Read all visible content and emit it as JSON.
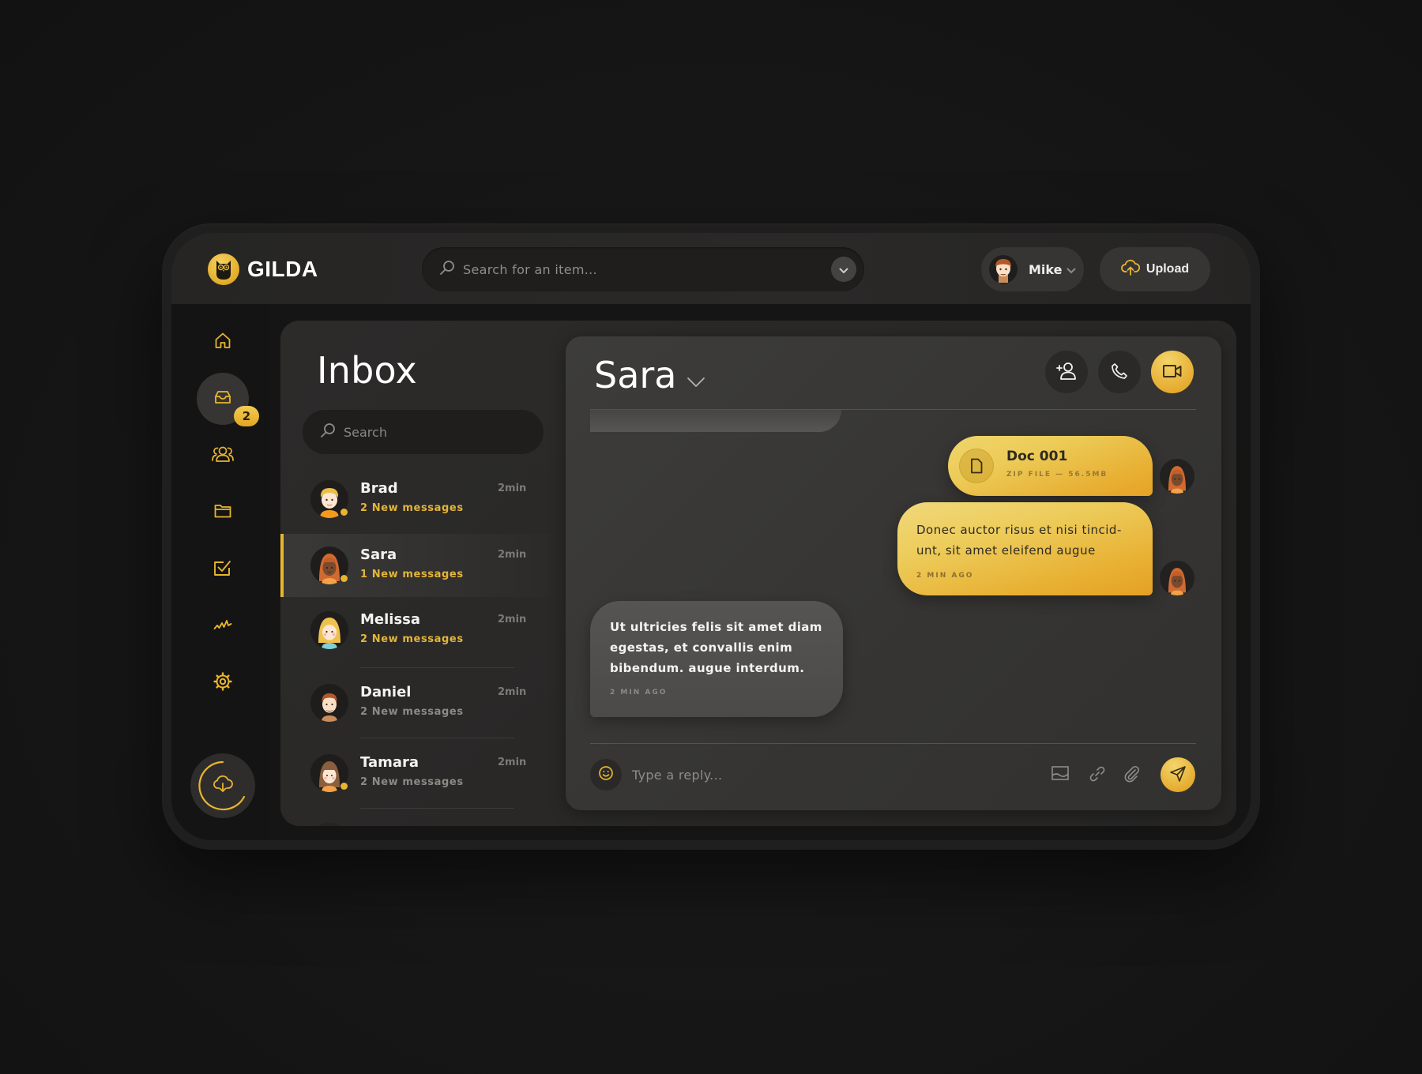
{
  "app": {
    "brand": "GILDA",
    "accent_color": "#E9B52F"
  },
  "topbar": {
    "search_placeholder": "Search for an item...",
    "user_name": "Mike",
    "upload_label": "Upload"
  },
  "sidebar": {
    "items": [
      {
        "name": "home",
        "icon": "home-icon"
      },
      {
        "name": "inbox",
        "icon": "inbox-icon",
        "active": true,
        "badge": "2"
      },
      {
        "name": "contacts",
        "icon": "users-icon"
      },
      {
        "name": "files",
        "icon": "folder-icon"
      },
      {
        "name": "tasks",
        "icon": "checkbox-icon"
      },
      {
        "name": "activity",
        "icon": "activity-icon"
      },
      {
        "name": "settings",
        "icon": "gear-icon"
      }
    ],
    "sync_icon": "cloud-download-icon"
  },
  "inbox": {
    "title": "Inbox",
    "search_placeholder": "Search",
    "conversations": [
      {
        "name": "Brad",
        "status": "2 New messages",
        "time": "2min",
        "unread": true,
        "online": true
      },
      {
        "name": "Sara",
        "status": "1 New messages",
        "time": "2min",
        "unread": true,
        "online": true,
        "active": true
      },
      {
        "name": "Melissa",
        "status": "2 New messages",
        "time": "2min",
        "unread": true,
        "online": false
      },
      {
        "name": "Daniel",
        "status": "2 New messages",
        "time": "2min",
        "unread": false,
        "online": false
      },
      {
        "name": "Tamara",
        "status": "2 New messages",
        "time": "2min",
        "unread": false,
        "online": true
      }
    ]
  },
  "chat": {
    "contact_name": "Sara",
    "messages": [
      {
        "type": "file",
        "file_name": "Doc 001",
        "file_meta": "ZIP FILE — 56.5MB",
        "outgoing": true
      },
      {
        "type": "text",
        "text": "Donec auctor risus et nisi tincid-unt, sit amet eleifend augue",
        "time": "2 MIN AGO",
        "outgoing": true
      },
      {
        "type": "text",
        "text": "Ut ultricies felis sit amet diam egestas, et convallis enim bibendum. augue interdum.",
        "time": "2 MIN AGO",
        "outgoing": false
      }
    ],
    "reply_placeholder": "Type a reply..."
  }
}
